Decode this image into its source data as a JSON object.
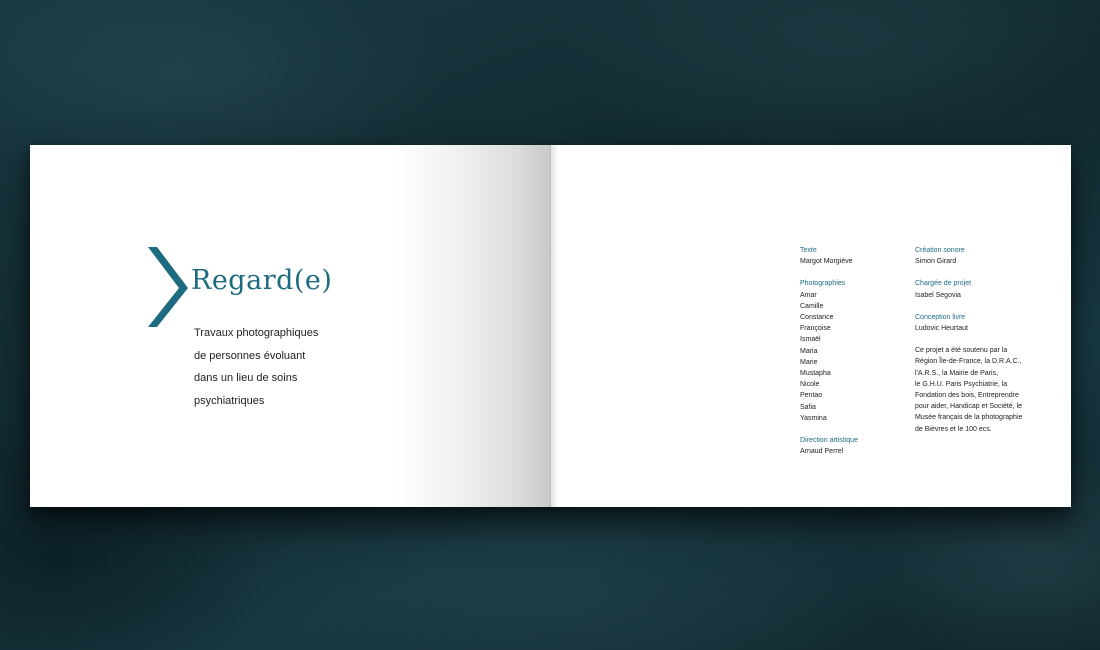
{
  "left_page": {
    "title": "Regard(e)",
    "subtitle_lines": [
      "Travaux photographiques",
      "de personnes évoluant",
      "dans un lieu de soins",
      "psychiatriques"
    ]
  },
  "right_page": {
    "column1": {
      "texte": {
        "label": "Texte",
        "value": "Margot Morgiève"
      },
      "photographies": {
        "label": "Photographies",
        "names": [
          "Amar",
          "Camille",
          "Constance",
          "Françoise",
          "Ismaël",
          "Maria",
          "Marie",
          "Mustapha",
          "Nicole",
          "Pentao",
          "Safia",
          "Yasmina"
        ]
      },
      "direction": {
        "label": "Direction artistique",
        "value": "Arnaud Perrel"
      }
    },
    "column2": {
      "creation_sonore": {
        "label": "Création sonore",
        "value": "Simon Girard"
      },
      "chargee_projet": {
        "label": "Chargée de projet",
        "value": "Isabel Segovia"
      },
      "conception_livre": {
        "label": "Conception livre",
        "value": "Ludovic Heurtaut"
      },
      "support_lines": [
        "Ce projet a été soutenu par la",
        "Région Île-de-France, la D.R.A.C.,",
        "l'A.R.S., la Mairie de Paris,",
        "le G.H.U. Paris Psychiatrie, la",
        "Fondation des bois, Entreprendre",
        "pour aider, Handicap et Société, le",
        "Musée français de la photographie",
        "de Bièvres et le 100 ecs."
      ]
    }
  },
  "colors": {
    "accent": "#1d6b80",
    "background": "#143039",
    "text": "#222222"
  },
  "icons": {
    "logo": "chevron-right-icon"
  }
}
